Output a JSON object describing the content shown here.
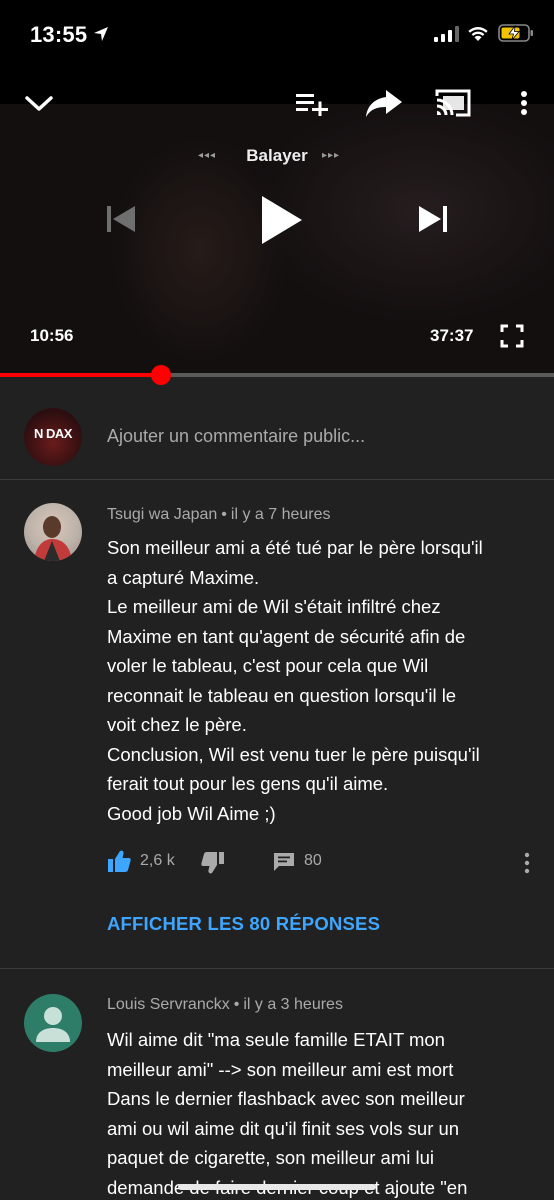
{
  "status_bar": {
    "time": "13:55"
  },
  "player": {
    "swipe_label": "Balayer",
    "swipe_left_arrows": "◂◂◂",
    "swipe_right_arrows": "▸▸▸",
    "current_time": "10:56",
    "total_time": "37:37",
    "progress_fraction": 0.29
  },
  "add_comment": {
    "avatar_text": "N DAX",
    "placeholder": "Ajouter un commentaire public..."
  },
  "comments": [
    {
      "author": "Tsugi wa Japan",
      "separator": "•",
      "age": "il y a 7 heures",
      "lines": [
        "Son meilleur ami a été tué par le père lorsqu'il",
        "a capturé Maxime.",
        "Le meilleur ami de Wil s'était infiltré chez",
        "Maxime en tant qu'agent de sécurité afin de",
        "voler le tableau, c'est pour cela que Wil",
        "reconnait le tableau en question lorsqu'il le",
        "voit chez le père.",
        "Conclusion, Wil est venu tuer le père puisqu'il",
        "ferait tout pour les gens qu'il aime.",
        "Good job Wil Aime ;)"
      ],
      "likes": "2,6 k",
      "replies_count": "80",
      "show_replies_label": "AFFICHER LES 80 RÉPONSES"
    },
    {
      "author": "Louis Servranckx",
      "separator": "•",
      "age": "il y a 3 heures",
      "lines": [
        "Wil aime dit \"ma seule famille ETAIT mon",
        "meilleur ami\" --> son meilleur ami est mort",
        "Dans le dernier flashback avec son meilleur",
        "ami ou wil aime dit qu'il finit ses vols sur un",
        "paquet de cigarette, son meilleur ami lui",
        "demande de faire dernier coup et ajoute \"en"
      ]
    }
  ],
  "colors": {
    "background": "#212121",
    "progress": "#ff0000",
    "link": "#3ea6ff",
    "like_active": "#3ea6ff",
    "secondary_text": "#aaaaaa"
  }
}
